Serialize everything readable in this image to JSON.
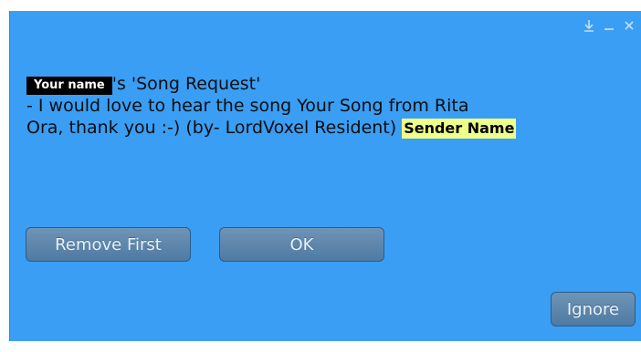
{
  "dialog": {
    "controls": {
      "dock_icon": "dock-icon",
      "minimize_icon": "minimize-icon",
      "close_icon": "close-icon"
    },
    "message": {
      "name_badge": "Your name",
      "line1_rest": "'s 'Song Request'",
      "line2": "- I would love to hear the song Your Song from Rita",
      "line3": "Ora, thank you :-) (by- LordVoxel Resident) ",
      "sender_badge": "Sender Name"
    },
    "buttons": {
      "remove_first": "Remove First",
      "ok": "OK",
      "ignore": "Ignore"
    }
  },
  "colors": {
    "window_bg": "#3a9ef5",
    "button_bg": "#5a84aa",
    "name_badge_bg": "#000000",
    "sender_badge_bg": "#efff8a"
  }
}
